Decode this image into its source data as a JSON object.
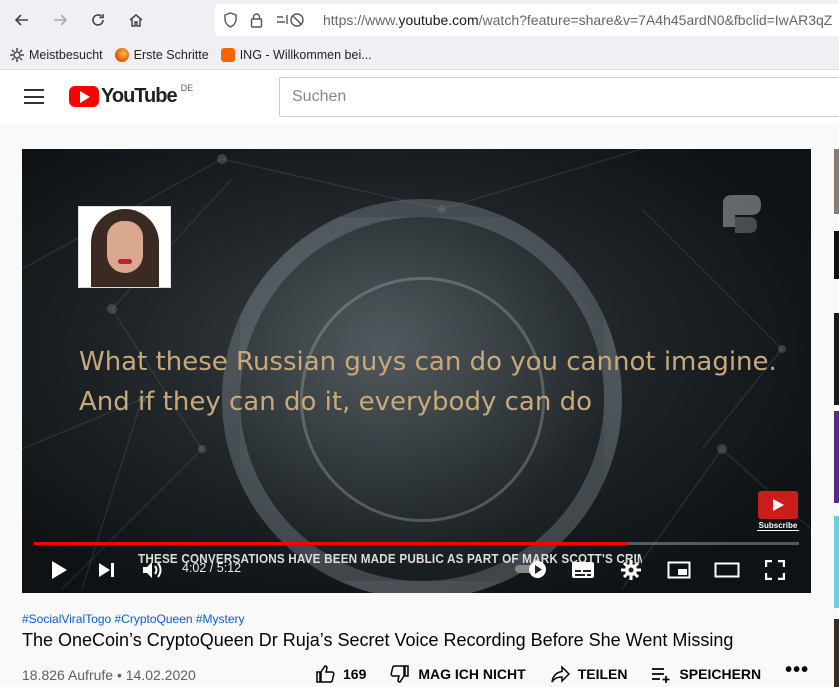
{
  "browser": {
    "back_icon": "arrow-left-icon",
    "forward_icon": "arrow-right-icon",
    "reload_icon": "reload-icon",
    "home_icon": "home-icon",
    "url_prefix": "https://www.",
    "url_domain": "youtube.com",
    "url_rest": "/watch?feature=share&v=7A4h45ardN0&fbclid=IwAR3qZ"
  },
  "bookmarks": [
    {
      "label": "Meistbesucht",
      "icon": "gear-icon"
    },
    {
      "label": "Erste Schritte",
      "icon": "firefox-icon"
    },
    {
      "label": "ING - Willkommen bei...",
      "icon": "ing-icon"
    }
  ],
  "header": {
    "logo_text": "YouTube",
    "country_code": "DE",
    "search_placeholder": "Suchen"
  },
  "player": {
    "subtitle_line1": "What these Russian guys can do you cannot imagine.",
    "subtitle_line2": "And if they can do it, everybody can do",
    "ticker": "THESE CONVERSATIONS HAVE BEEN MADE PUBLIC AS PART OF MARK SCOTT'S CRIMINAL TRIAL",
    "subscribe_label": "Subscribe",
    "current_time": "4:02",
    "duration": "5:12",
    "time_display": "4:02 / 5:12",
    "progress_fraction": 0.776
  },
  "video": {
    "hashtags": "#SocialViralTogo #CryptoQueen #Mystery",
    "title": "The OneCoin’s CryptoQueen Dr Ruja’s Secret Voice Recording Before She Went Missing",
    "meta": "18.826 Aufrufe • 14.02.2020",
    "likes": "169",
    "dislike_label": "MAG ICH NICHT",
    "share_label": "TEILEN",
    "save_label": "SPEICHERN",
    "more_label": "•••"
  },
  "colors": {
    "accent": "#ff0000",
    "link": "#065fd4",
    "subtitle": "#c8a97a"
  }
}
